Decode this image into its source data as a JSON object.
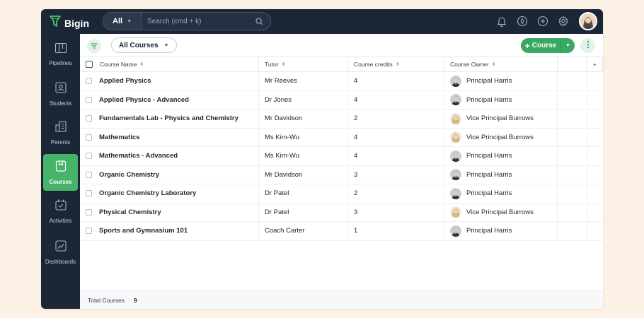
{
  "colors": {
    "background": "#fbf1e4",
    "topbar": "#1b2637",
    "accent_green": "#46b36b",
    "button_green": "#3aa864"
  },
  "app": {
    "name": "Bigin",
    "logo_icon": "funnel-logo-icon"
  },
  "search": {
    "scope": "All",
    "placeholder": "Search (cmd + k)"
  },
  "topbar_icons": [
    "bell-icon",
    "compass-icon",
    "add-circle-icon",
    "gear-icon"
  ],
  "sidebar": {
    "items": [
      {
        "label": "Pipelines",
        "icon": "pipelines-icon",
        "active": false
      },
      {
        "label": "Students",
        "icon": "students-icon",
        "active": false
      },
      {
        "label": "Parents",
        "icon": "parents-icon",
        "active": false
      },
      {
        "label": "Courses",
        "icon": "courses-icon",
        "active": true
      },
      {
        "label": "Activities",
        "icon": "activities-icon",
        "active": false
      },
      {
        "label": "Dashboards",
        "icon": "dashboards-icon",
        "active": false
      }
    ]
  },
  "toolbar": {
    "view_label": "All Courses",
    "add_label": "Course"
  },
  "table": {
    "headers": {
      "name": "Course Name",
      "tutor": "Tutor",
      "credits": "Course credits",
      "owner": "Course Owner",
      "add_column": "+"
    },
    "rows": [
      {
        "name": "Applied Physics",
        "tutor": "Mr Reeves",
        "credits": "4",
        "owner": "Principal Harris",
        "owner_type": "harris"
      },
      {
        "name": "Applied Physics - Advanced",
        "tutor": "Dr Jones",
        "credits": "4",
        "owner": "Principal Harris",
        "owner_type": "harris"
      },
      {
        "name": "Fundamentals Lab - Physics and Chemistry",
        "tutor": "Mr Davidson",
        "credits": "2",
        "owner": "Vice Principal Burrows",
        "owner_type": "burrows"
      },
      {
        "name": "Mathematics",
        "tutor": "Ms Kim-Wu",
        "credits": "4",
        "owner": "Vice Principal Burrows",
        "owner_type": "burrows"
      },
      {
        "name": "Mathematics - Advanced",
        "tutor": "Ms Kim-Wu",
        "credits": "4",
        "owner": "Principal Harris",
        "owner_type": "harris"
      },
      {
        "name": "Organic Chemistry",
        "tutor": "Mr Davidson",
        "credits": "3",
        "owner": "Principal Harris",
        "owner_type": "harris"
      },
      {
        "name": "Organic Chemistry Laboratory",
        "tutor": "Dr Patel",
        "credits": "2",
        "owner": "Principal Harris",
        "owner_type": "harris"
      },
      {
        "name": "Physical Chemistry",
        "tutor": "Dr Patel",
        "credits": "3",
        "owner": "Vice Principal Burrows",
        "owner_type": "burrows"
      },
      {
        "name": "Sports and Gymnasium 101",
        "tutor": "Coach Carter",
        "credits": "1",
        "owner": "Principal Harris",
        "owner_type": "harris"
      }
    ]
  },
  "footer": {
    "label": "Total Courses",
    "count": "9"
  }
}
